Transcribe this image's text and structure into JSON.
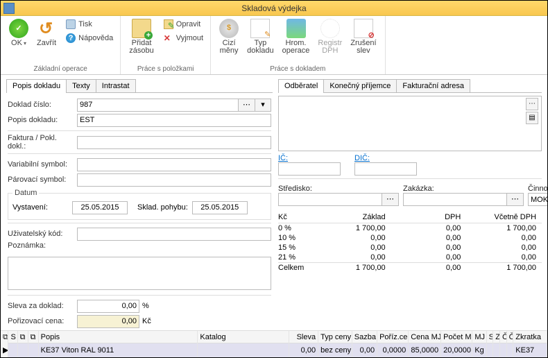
{
  "window": {
    "title": "Skladová výdejka"
  },
  "ribbon": {
    "ok": "OK",
    "close": "Zavřít",
    "print": "Tisk",
    "help": "Nápověda",
    "group_basic": "Základní operace",
    "add_stock": "Přidat\nzásobu",
    "edit": "Opravit",
    "cut": "Vyjmout",
    "group_items": "Práce s položkami",
    "currency": "Cizí\nměny",
    "doctype": "Typ\ndokladu",
    "bulk": "Hrom.\noperace",
    "registr": "Registr\nDPH",
    "cancel_disc": "Zrušení\nslev",
    "group_doc": "Práce s dokladem"
  },
  "tabs_inner": {
    "popis": "Popis dokladu",
    "texty": "Texty",
    "intrastat": "Intrastat"
  },
  "tabs_partner": {
    "odberatel": "Odběratel",
    "prijemce": "Konečný příjemce",
    "faktur": "Fakturační adresa"
  },
  "form": {
    "doklad_cislo_lbl": "Doklad číslo:",
    "doklad_cislo_val": "987",
    "popis_dokladu_lbl": "Popis dokladu:",
    "popis_dokladu_val": "EST",
    "faktura_lbl": "Faktura / Pokl. dokl.:",
    "faktura_val": "",
    "varsym_lbl": "Variabilní symbol:",
    "varsym_val": "",
    "parsym_lbl": "Párovací symbol:",
    "parsym_val": "",
    "datum_legend": "Datum",
    "vystaveni_lbl": "Vystavení:",
    "vystaveni_val": "25.05.2015",
    "sklad_lbl": "Sklad. pohybu:",
    "sklad_val": "25.05.2015",
    "usercode_lbl": "Uživatelský kód:",
    "usercode_val": "",
    "pozn_lbl": "Poznámka:",
    "pozn_val": "",
    "sleva_lbl": "Sleva za doklad:",
    "sleva_val": "0,00",
    "sleva_suffix": "%",
    "poriz_lbl": "Pořizovací cena:",
    "poriz_val": "0,00",
    "poriz_suffix": "Kč"
  },
  "ids": {
    "ic_lbl": "IČ:",
    "ic_val": "",
    "dic_lbl": "DIČ:",
    "dic_val": ""
  },
  "mid": {
    "stredisko_lbl": "Středisko:",
    "stredisko_val": "",
    "zakazka_lbl": "Zakázka:",
    "zakazka_val": "",
    "cinnost_lbl": "Činnost:",
    "cinnost_val": "MOKRÁ"
  },
  "vat": {
    "hdr_kc": "Kč",
    "hdr_zaklad": "Základ",
    "hdr_dph": "DPH",
    "hdr_vcetne": "Včetně DPH",
    "rows": [
      {
        "rate": "0 %",
        "zaklad": "1 700,00",
        "dph": "0,00",
        "vcetne": "1 700,00"
      },
      {
        "rate": "10 %",
        "zaklad": "0,00",
        "dph": "0,00",
        "vcetne": "0,00"
      },
      {
        "rate": "15 %",
        "zaklad": "0,00",
        "dph": "0,00",
        "vcetne": "0,00"
      },
      {
        "rate": "21 %",
        "zaklad": "0,00",
        "dph": "0,00",
        "vcetne": "0,00"
      }
    ],
    "total_lbl": "Celkem",
    "total_zaklad": "1 700,00",
    "total_dph": "0,00",
    "total_vcetne": "1 700,00"
  },
  "grid": {
    "headers": {
      "s": "S",
      "popis": "Popis",
      "katalog": "Katalog",
      "sleva": "Sleva",
      "typceny": "Typ ceny",
      "sazba": "Sazba l",
      "porizcena": "Poříz.cen",
      "cenamj": "Cena MJ",
      "pocetmj": "Počet M.",
      "mj": "MJ",
      "s1": "S",
      "z": "Z",
      "c1": "Č",
      "c2": "Č",
      "zkratka": "Zkratka"
    },
    "row": {
      "popis": "KE37 Viton  RAL 9011",
      "katalog": "",
      "sleva": "0,00",
      "typceny": "bez ceny",
      "sazba": "0,00",
      "porizcena": "0,0000",
      "cenamj": "85,0000",
      "pocetmj": "20,0000",
      "mj": "Kg",
      "zkratka": "KE37"
    }
  }
}
